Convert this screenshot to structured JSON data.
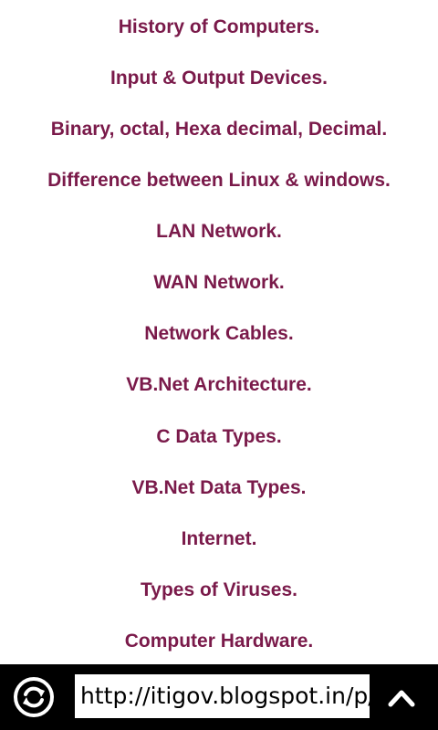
{
  "links": [
    "History of Computers.",
    "Input & Output Devices.",
    "Binary, octal, Hexa decimal, Decimal.",
    "Difference between Linux & windows.",
    "LAN Network.",
    "WAN Network.",
    "Network Cables.",
    "VB.Net Architecture.",
    "C Data Types.",
    "VB.Net Data Types.",
    "Internet.",
    "Types of Viruses.",
    "Computer Hardware."
  ],
  "toolbar": {
    "url": "http://itigov.blogspot.in/p/",
    "refresh_icon": "refresh-icon",
    "up_icon": "chevron-up-icon"
  },
  "colors": {
    "link": "#7a1a4a",
    "toolbar_bg": "#000000",
    "page_bg": "#ffffff"
  }
}
